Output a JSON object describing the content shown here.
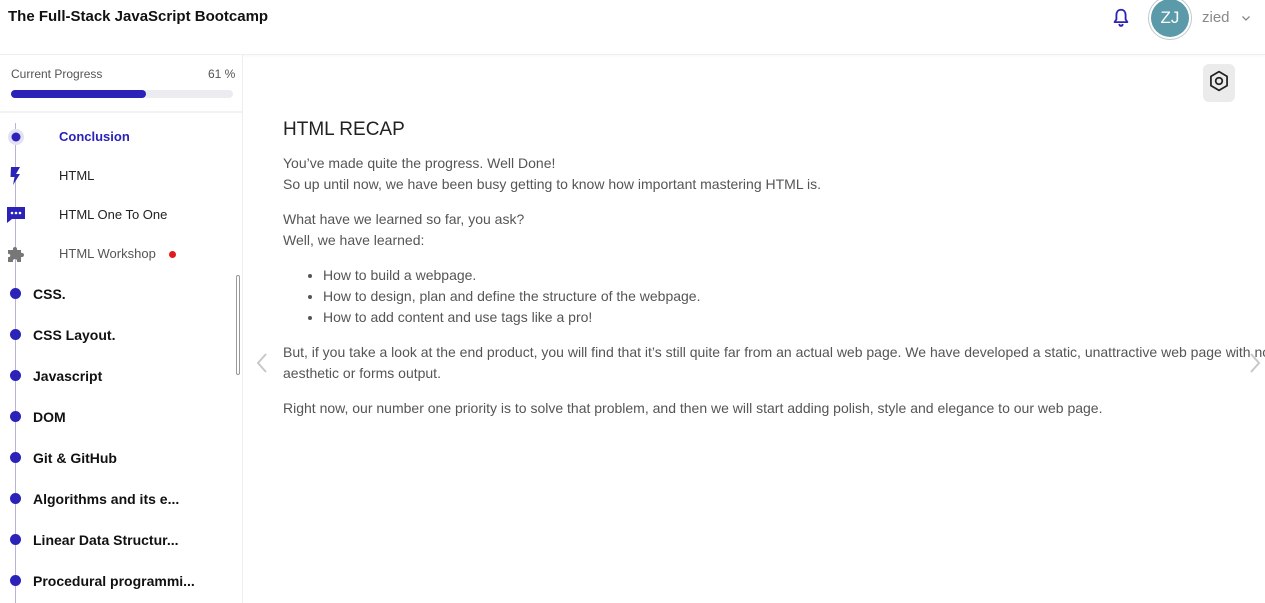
{
  "header": {
    "course_title": "The Full-Stack JavaScript Bootcamp",
    "user": {
      "initials": "ZJ",
      "name": "zied"
    }
  },
  "sidebar": {
    "progress": {
      "label": "Current Progress",
      "percent_text": "61 %",
      "value": 0.61
    },
    "sub_items": [
      {
        "label": "Conclusion",
        "icon": "circle-dot-icon",
        "state": "active"
      },
      {
        "label": "HTML",
        "icon": "lightning-icon",
        "state": "normal"
      },
      {
        "label": "HTML One To One",
        "icon": "chat-icon",
        "state": "normal"
      },
      {
        "label": "HTML Workshop",
        "icon": "puzzle-icon",
        "state": "muted",
        "new_badge": true
      }
    ],
    "chapters": [
      {
        "label": "CSS."
      },
      {
        "label": "CSS Layout."
      },
      {
        "label": "Javascript"
      },
      {
        "label": "DOM"
      },
      {
        "label": "Git & GitHub"
      },
      {
        "label": "Algorithms and its e..."
      },
      {
        "label": "Linear Data Structur..."
      },
      {
        "label": "Procedural programmi..."
      }
    ]
  },
  "lesson": {
    "title": "HTML RECAP",
    "paragraphs": {
      "p1_line1": "You’ve made quite the progress. Well Done!",
      "p1_line2": "So up until now, we have been busy getting to know how important mastering HTML is.",
      "p2_line1": "What have we learned so far, you ask?",
      "p2_line2": "Well, we have learned:",
      "p3": "But, if you take a look at the end product, you will find that it’s still quite far from an actual web page. We have developed a static, unattractive web page with no aesthetic or forms output.",
      "p4": "Right now, our number one priority is to solve that problem, and then we will start adding polish, style and elegance to our web page."
    },
    "bullets": [
      "How to build a webpage.",
      "How to design, plan and define the structure of the webpage.",
      "How to add content and use tags like a pro!"
    ]
  },
  "colors": {
    "accent": "#2b22b8",
    "avatar_bg": "#5b9aa8",
    "badge_red": "#e01b1b"
  },
  "icons": {
    "notification": "bell-icon",
    "settings": "gear-icon",
    "user_menu": "chevron-down-icon",
    "prev": "chevron-left-icon",
    "next": "chevron-right-icon"
  }
}
